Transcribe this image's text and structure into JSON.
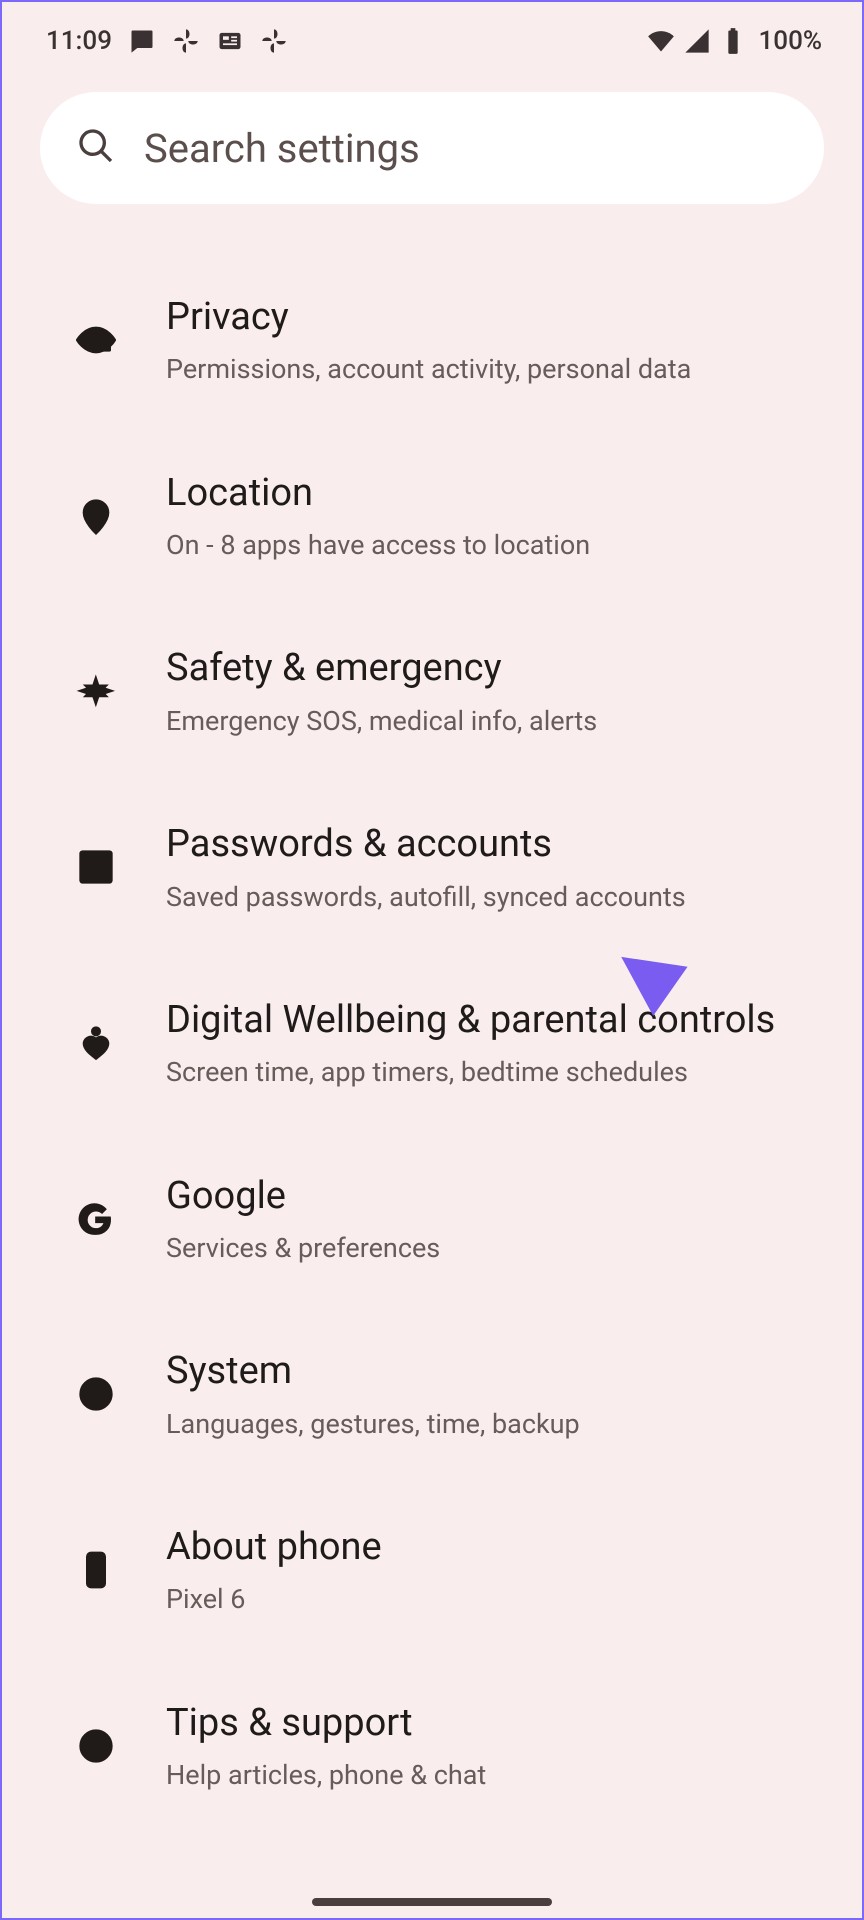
{
  "status": {
    "time": "11:09",
    "battery": "100%"
  },
  "search": {
    "placeholder": "Search settings"
  },
  "items": [
    {
      "title": "Privacy",
      "sub": "Permissions, account activity, personal data"
    },
    {
      "title": "Location",
      "sub": "On - 8 apps have access to location"
    },
    {
      "title": "Safety & emergency",
      "sub": "Emergency SOS, medical info, alerts"
    },
    {
      "title": "Passwords & accounts",
      "sub": "Saved passwords, autofill, synced accounts"
    },
    {
      "title": "Digital Wellbeing & parental controls",
      "sub": "Screen time, app timers, bedtime schedules"
    },
    {
      "title": "Google",
      "sub": "Services & preferences"
    },
    {
      "title": "System",
      "sub": "Languages, gestures, time, backup"
    },
    {
      "title": "About phone",
      "sub": "Pixel 6"
    },
    {
      "title": "Tips & support",
      "sub": "Help articles, phone & chat"
    }
  ]
}
